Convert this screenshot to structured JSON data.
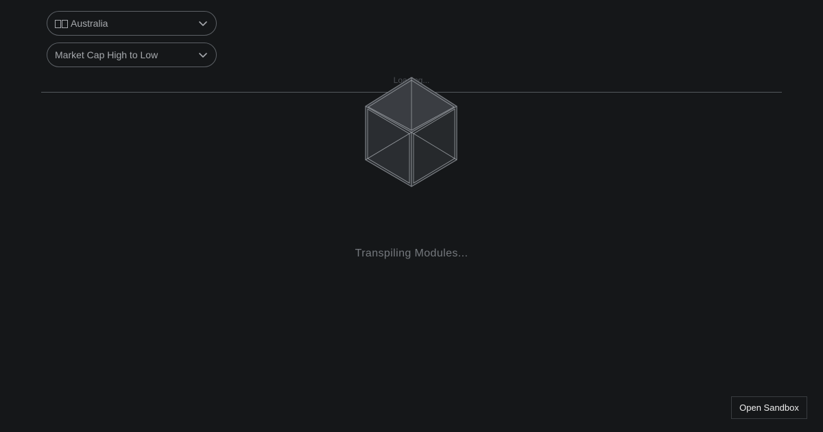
{
  "filters": {
    "country": {
      "label": "Australia",
      "flag_glyph": "flag-icon"
    },
    "sort": {
      "label": "Market Cap High to Low"
    }
  },
  "loader": {
    "overlay_label": "Loading...",
    "status_text": "Transpiling Modules..."
  },
  "actions": {
    "open_sandbox_label": "Open Sandbox"
  },
  "colors": {
    "background": "#151719",
    "border": "#5d6166",
    "text_muted": "#a6a9ad"
  }
}
